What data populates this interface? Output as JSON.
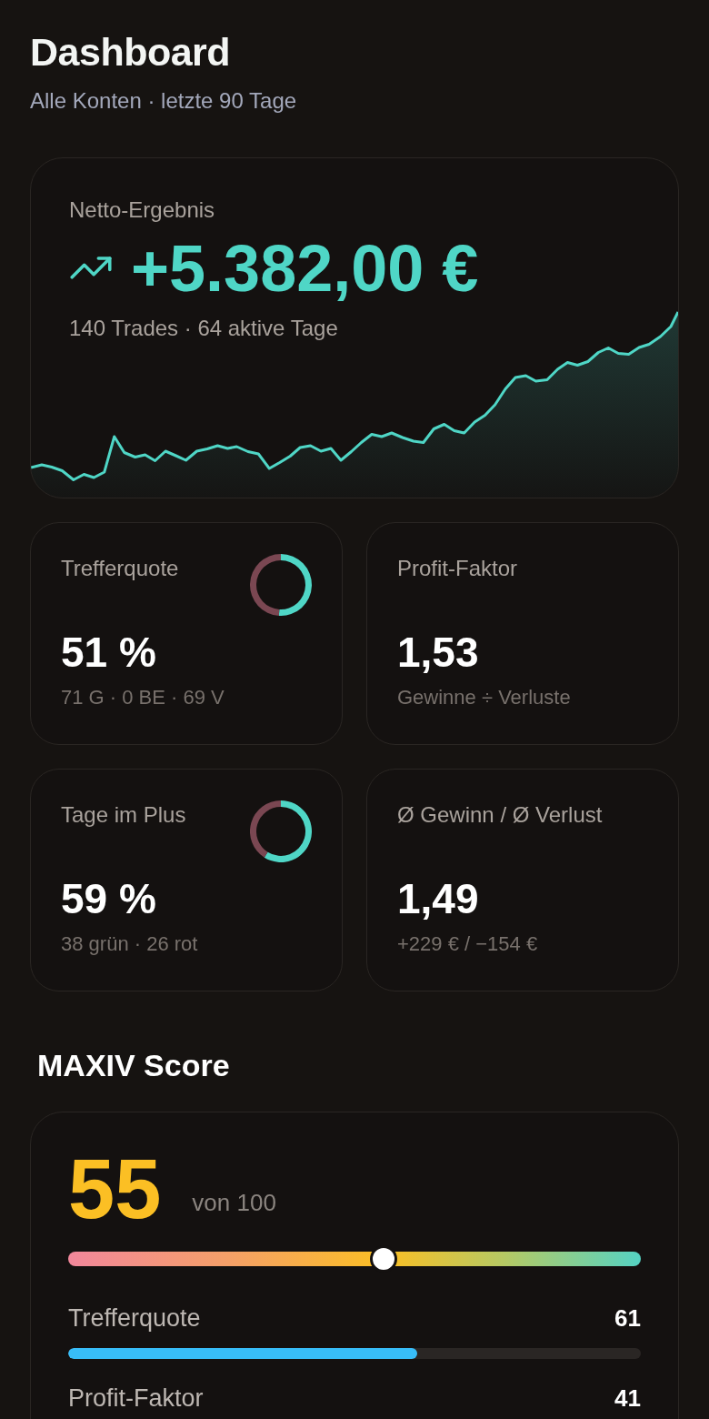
{
  "header": {
    "title": "Dashboard",
    "subtitle": "Alle Konten · letzte 90 Tage"
  },
  "net_result": {
    "label": "Netto-Ergebnis",
    "positive": true,
    "value": "+5.382,00 €",
    "summary": "140 Trades · 64 aktive Tage"
  },
  "stats": [
    {
      "label": "Trefferquote",
      "kind": "ring",
      "chart_data": {
        "type": "donut",
        "values": [
          51,
          49
        ]
      },
      "value": "51 %",
      "detail": "71 G · 0 BE · 69 V"
    },
    {
      "label": "Profit-Faktor",
      "kind": "plain",
      "value": "1,53",
      "detail": "Gewinne ÷ Verluste"
    },
    {
      "label": "Tage im Plus",
      "kind": "ring",
      "chart_data": {
        "type": "donut",
        "values": [
          59,
          41
        ]
      },
      "value": "59 %",
      "detail": "38 grün · 26 rot"
    },
    {
      "label": "Ø Gewinn / Ø Verlust",
      "kind": "plain",
      "value": "1,49",
      "detail": "+229 € / −154 €"
    }
  ],
  "score": {
    "title": "MAXIV Score",
    "value": "55",
    "scale": "von 100",
    "level": 0.55,
    "components": [
      {
        "label": "Trefferquote",
        "value": "61",
        "level": 0.61
      },
      {
        "label": "Profit-Faktor",
        "value": "41"
      }
    ]
  }
}
